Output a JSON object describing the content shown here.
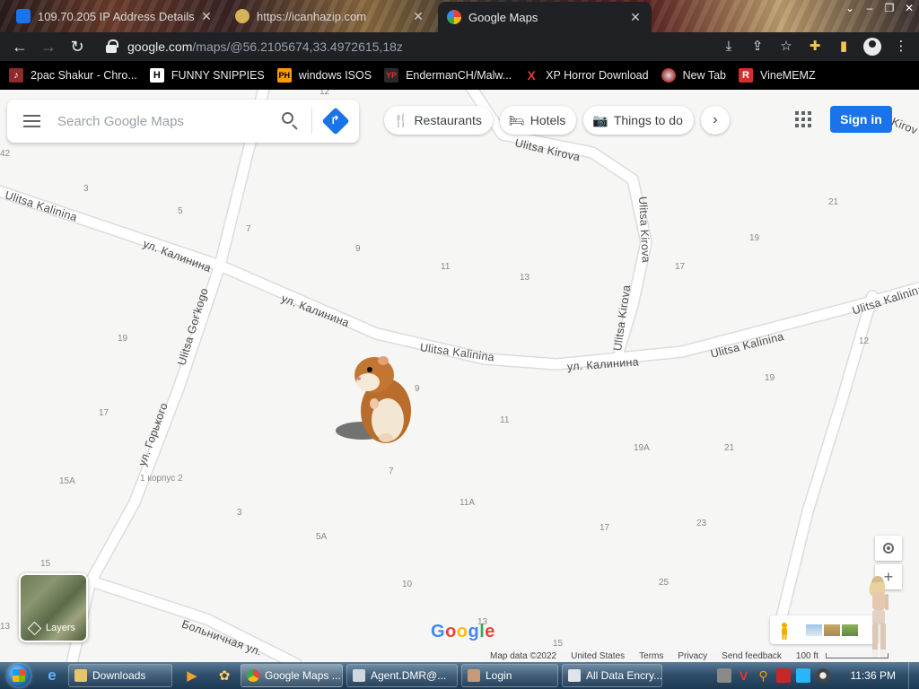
{
  "browser": {
    "tabs": [
      {
        "title": "109.70.205 IP Address Details",
        "active": false
      },
      {
        "title": "https://icanhazip.com",
        "active": false
      },
      {
        "title": "Google Maps",
        "active": true
      }
    ],
    "url_host": "google.com",
    "url_path": "/maps/@56.2105674,33.4972615,18z",
    "bookmarks": [
      {
        "label": "2pac Shakur - Chro...",
        "icon": "music-icon",
        "color": "#c0392b"
      },
      {
        "label": "FUNNY SNIPPIES",
        "icon": "H",
        "color": "#ffffff"
      },
      {
        "label": "windows ISOS",
        "icon": "PH",
        "color": "#ff9900"
      },
      {
        "label": "EndermanCH/Malw...",
        "icon": "YP",
        "color": "#b71c1c"
      },
      {
        "label": "XP Horror Download",
        "icon": "X",
        "color": "#d32f2f"
      },
      {
        "label": "New Tab",
        "icon": "globe-icon",
        "color": "#cc3d3d"
      },
      {
        "label": "VineMEMZ",
        "icon": "R",
        "color": "#d32f2f"
      }
    ]
  },
  "maps": {
    "search_placeholder": "Search Google Maps",
    "chips": [
      {
        "label": "Restaurants",
        "icon": "fork-knife-icon"
      },
      {
        "label": "Hotels",
        "icon": "bed-icon"
      },
      {
        "label": "Things to do",
        "icon": "camera-icon"
      }
    ],
    "sign_in": "Sign in",
    "layers_label": "Layers",
    "logo": "Google",
    "footer": {
      "map_data": "Map data ©2022",
      "country": "United States",
      "terms": "Terms",
      "privacy": "Privacy",
      "feedback": "Send feedback",
      "scale": "100 ft"
    },
    "streets": [
      "Ulitsa Kalinina",
      "ул. Калинина",
      "ул. Калинина",
      "Ulitsa Kalinina",
      "ул. Калинина",
      "Ulitsa Kalinina",
      "Ulitsa Kalinina",
      "Ulitsa Kirova",
      "Ulitsa Kirova",
      "Ulitsa Kirova",
      "Ulitsa Gor'kogo",
      "ул. Горького",
      "Больничная ул.",
      "Kirov"
    ],
    "house_numbers": [
      "12",
      "42",
      "3",
      "5",
      "7",
      "9",
      "11",
      "13",
      "17",
      "19",
      "21",
      "19",
      "12",
      "19",
      "17",
      "9",
      "11",
      "19A",
      "21",
      "15A",
      "1 корпус 2",
      "3",
      "5A",
      "11A",
      "17",
      "23",
      "7",
      "15",
      "10",
      "25",
      "13",
      "13",
      "15"
    ]
  },
  "taskbar": {
    "buttons": [
      {
        "label": "Downloads"
      },
      {
        "label": "Google Maps ..."
      },
      {
        "label": "Agent.DMR@..."
      },
      {
        "label": "Login"
      },
      {
        "label": "All Data Encry..."
      }
    ],
    "clock": "11:36 PM"
  },
  "colors": {
    "accent": "#1a73e8",
    "browser_dark": "#202124",
    "map_bg": "#f6f6f4",
    "road": "#ffffff",
    "road_edge": "#dadada"
  }
}
